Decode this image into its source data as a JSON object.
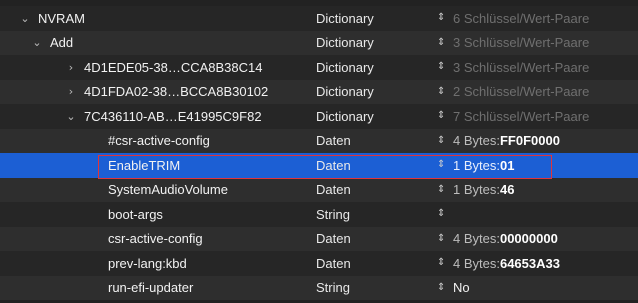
{
  "rows": [
    {
      "key": "NVRAM",
      "type": "Dictionary",
      "value_head": "6 Schlüssel/Wert-Paare",
      "value_num": "",
      "chevron": "⌄",
      "value_dim": true
    },
    {
      "key": "Add",
      "type": "Dictionary",
      "value_head": "3 Schlüssel/Wert-Paare",
      "value_num": "",
      "chevron": "⌄",
      "value_dim": true
    },
    {
      "key": "4D1EDE05-38…CCA8B38C14",
      "type": "Dictionary",
      "value_head": "3 Schlüssel/Wert-Paare",
      "value_num": "",
      "chevron": "›",
      "value_dim": true
    },
    {
      "key": "4D1FDA02-38…BCCA8B30102",
      "type": "Dictionary",
      "value_head": "2 Schlüssel/Wert-Paare",
      "value_num": "",
      "chevron": "›",
      "value_dim": true
    },
    {
      "key": "7C436110-AB…E41995C9F82",
      "type": "Dictionary",
      "value_head": "7 Schlüssel/Wert-Paare",
      "value_num": "",
      "chevron": "⌄",
      "value_dim": true
    },
    {
      "key": "#csr-active-config",
      "type": "Daten",
      "value_head": "4 Bytes: ",
      "value_num": "FF0F0000",
      "chevron": "",
      "value_dim": false
    },
    {
      "key": "EnableTRIM",
      "type": "Daten",
      "value_head": "1 Bytes: ",
      "value_num": "01",
      "chevron": "",
      "value_dim": false
    },
    {
      "key": "SystemAudioVolume",
      "type": "Daten",
      "value_head": "1 Bytes: ",
      "value_num": "46",
      "chevron": "",
      "value_dim": false
    },
    {
      "key": "boot-args",
      "type": "String",
      "value_head": "",
      "value_num": "",
      "chevron": "",
      "value_dim": false
    },
    {
      "key": "csr-active-config",
      "type": "Daten",
      "value_head": "4 Bytes: ",
      "value_num": "00000000",
      "chevron": "",
      "value_dim": false
    },
    {
      "key": "prev-lang:kbd",
      "type": "Daten",
      "value_head": "4 Bytes: ",
      "value_num": "64653A33",
      "chevron": "",
      "value_dim": false
    },
    {
      "key": "run-efi-updater",
      "type": "String",
      "value_head": "No",
      "value_num": "",
      "chevron": "",
      "value_dim": false
    }
  ],
  "stepper_glyph": "⇕",
  "selected_row": "EnableTRIM",
  "colors": {
    "selection": "#1c5fd4",
    "highlight_border": "#e0343a"
  }
}
